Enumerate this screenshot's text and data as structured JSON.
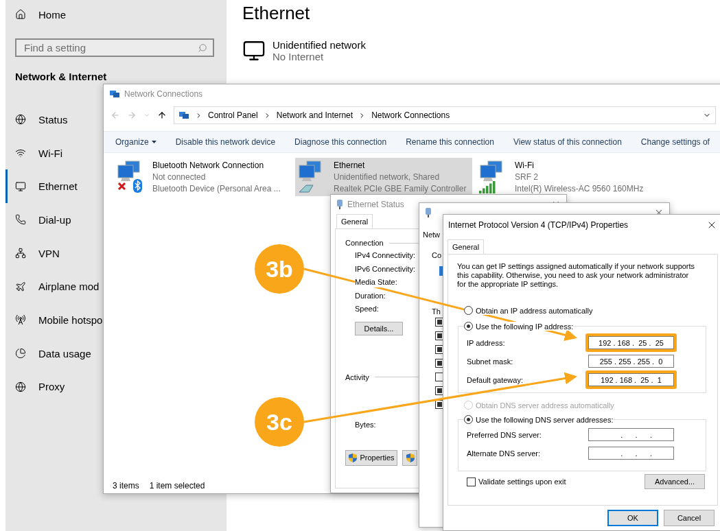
{
  "settings": {
    "home": "Home",
    "search_placeholder": "Find a setting",
    "section": "Network & Internet",
    "nav": [
      {
        "label": "Status",
        "selected": false
      },
      {
        "label": "Wi-Fi",
        "selected": false
      },
      {
        "label": "Ethernet",
        "selected": true
      },
      {
        "label": "Dial-up",
        "selected": false
      },
      {
        "label": "VPN",
        "selected": false
      },
      {
        "label": "Airplane mod",
        "selected": false
      },
      {
        "label": "Mobile hotspo",
        "selected": false
      },
      {
        "label": "Data usage",
        "selected": false
      },
      {
        "label": "Proxy",
        "selected": false
      }
    ],
    "title": "Ethernet",
    "network": {
      "name": "Unidentified network",
      "status": "No Internet"
    }
  },
  "connections_window": {
    "title": "Network Connections",
    "breadcrumb": [
      "Control Panel",
      "Network and Internet",
      "Network Connections"
    ],
    "toolbar": [
      {
        "label": "Organize",
        "dropdown": true
      },
      {
        "label": "Disable this network device",
        "dropdown": false
      },
      {
        "label": "Diagnose this connection",
        "dropdown": false
      },
      {
        "label": "Rename this connection",
        "dropdown": false
      },
      {
        "label": "View status of this connection",
        "dropdown": false
      },
      {
        "label": "Change settings of",
        "dropdown": false
      }
    ],
    "items": [
      {
        "kind": "bluetooth",
        "name": "Bluetooth Network Connection",
        "status": "Not connected",
        "device": "Bluetooth Device (Personal Area ...",
        "selected": false
      },
      {
        "kind": "ethernet",
        "name": "Ethernet",
        "status": "Unidentified network, Shared",
        "device": "Realtek PCIe GBE Family Controller",
        "selected": true
      },
      {
        "kind": "wifi",
        "name": "Wi-Fi",
        "status": "SRF 2",
        "device": "Intel(R) Wireless-AC 9560 160MHz",
        "selected": false
      }
    ],
    "status_bar": [
      "3 items",
      "1 item selected"
    ]
  },
  "status_window": {
    "title": "Ethernet Status",
    "tab": "General",
    "connection_heading": "Connection",
    "connection_fields": [
      "IPv4 Connectivity:",
      "IPv6 Connectivity:",
      "Media State:",
      "Duration:",
      "Speed:"
    ],
    "details_button": "Details...",
    "activity_heading": "Activity",
    "bytes_label": "Bytes:",
    "properties_button": "Properties"
  },
  "properties_window": {
    "tab": "Netw",
    "connect_label": "Co",
    "items_label": "Th",
    "list": [
      true,
      true,
      true,
      true,
      false,
      true,
      true
    ]
  },
  "ipv4_dialog": {
    "title": "Internet Protocol Version 4 (TCP/IPv4) Properties",
    "tab": "General",
    "description": "You can get IP settings assigned automatically if your network supports this capability. Otherwise, you need to ask your network administrator for the appropriate IP settings.",
    "ip_options": [
      {
        "label": "Obtain an IP address automatically",
        "selected": false,
        "disabled": false
      },
      {
        "label": "Use the following IP address:",
        "selected": true,
        "disabled": false
      }
    ],
    "ip_fields": [
      {
        "label": "IP address:",
        "value": "192 . 168 .  25 .  25",
        "highlighted": true
      },
      {
        "label": "Subnet mask:",
        "value": "255 . 255 . 255 .  0",
        "highlighted": false
      },
      {
        "label": "Default gateway:",
        "value": "192 . 168 .  25 .  1",
        "highlighted": true
      }
    ],
    "dns_options": [
      {
        "label": "Obtain DNS server address automatically",
        "selected": false,
        "disabled": true
      },
      {
        "label": "Use the following DNS server addresses:",
        "selected": true,
        "disabled": false
      }
    ],
    "dns_fields": [
      {
        "label": "Preferred DNS server:",
        "value": "     .      .      .",
        "highlighted": false
      },
      {
        "label": "Alternate DNS server:",
        "value": "     .      .      .",
        "highlighted": false
      }
    ],
    "validate": {
      "label": "Validate settings upon exit",
      "checked": false
    },
    "advanced_button": "Advanced...",
    "ok_button": "OK",
    "cancel_button": "Cancel"
  },
  "callouts": [
    {
      "label": "3b"
    },
    {
      "label": "3c"
    }
  ]
}
